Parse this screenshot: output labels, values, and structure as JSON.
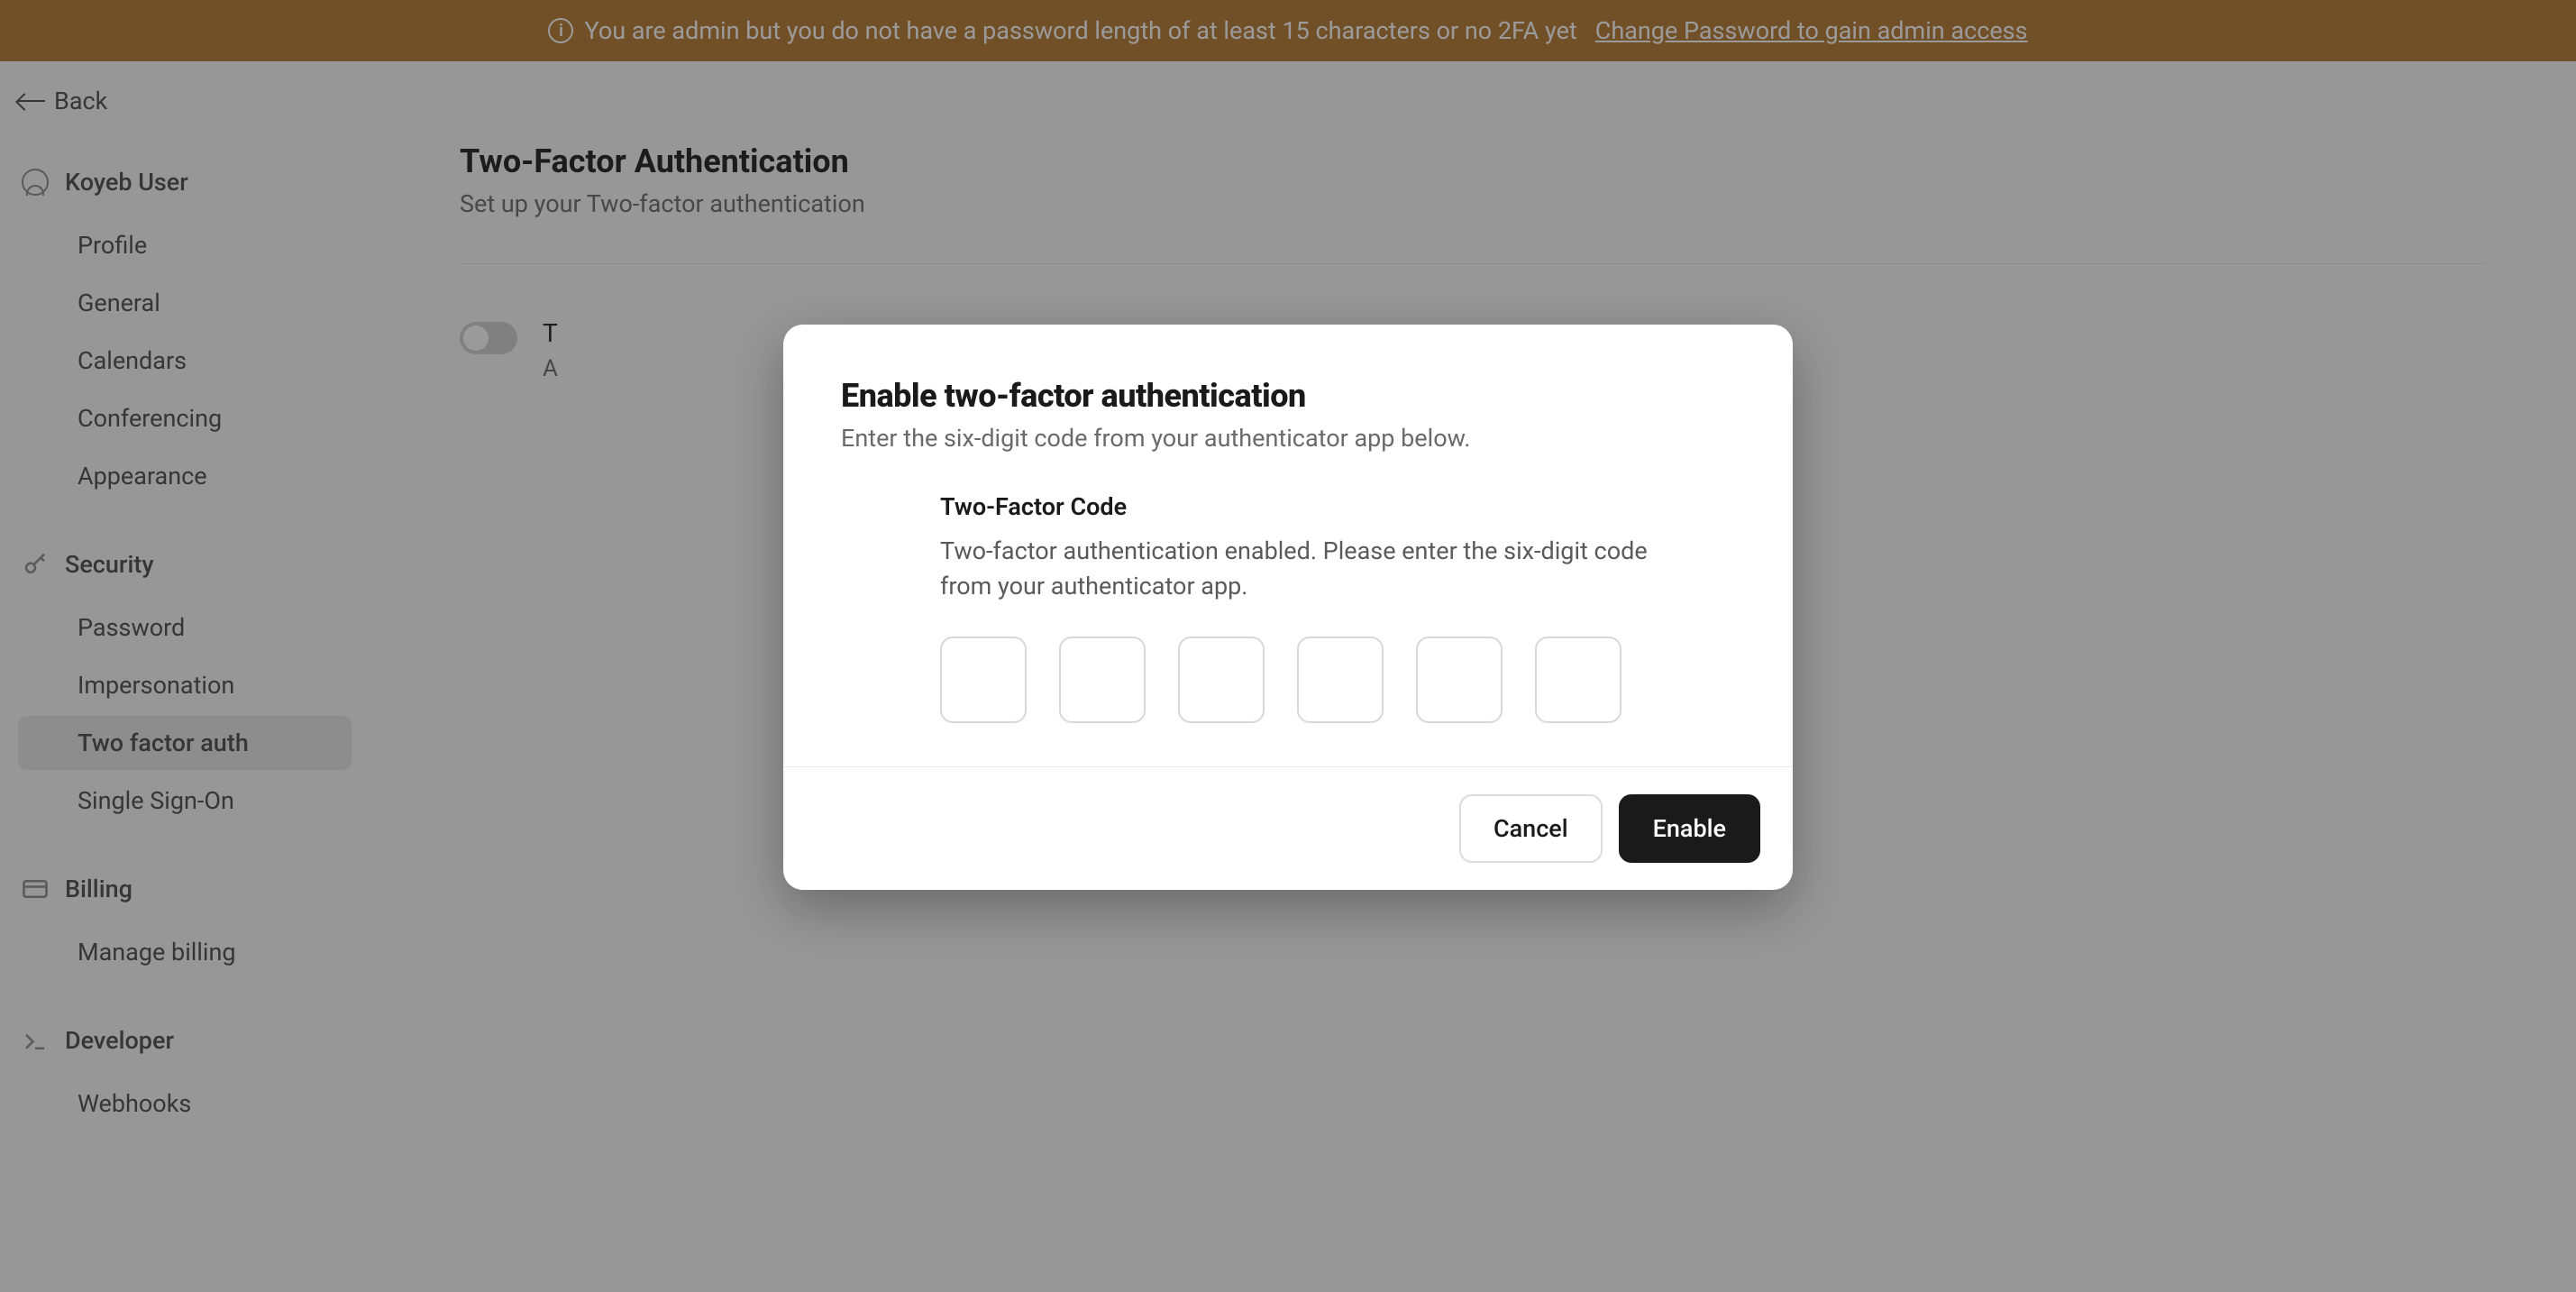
{
  "banner": {
    "text": "You are admin but you do not have a password length of at least 15 characters or no 2FA yet",
    "link_text": "Change Password to gain admin access"
  },
  "back_label": "Back",
  "sidebar": {
    "user_section": {
      "label": "Koyeb User",
      "items": [
        "Profile",
        "General",
        "Calendars",
        "Conferencing",
        "Appearance"
      ]
    },
    "security_section": {
      "label": "Security",
      "items": [
        "Password",
        "Impersonation",
        "Two factor auth",
        "Single Sign-On"
      ],
      "active_index": 2
    },
    "billing_section": {
      "label": "Billing",
      "items": [
        "Manage billing"
      ]
    },
    "developer_section": {
      "label": "Developer",
      "items": [
        "Webhooks"
      ]
    }
  },
  "page": {
    "title": "Two-Factor Authentication",
    "subtitle": "Set up your Two-factor authentication",
    "toggle_label": "T",
    "toggle_desc": "A"
  },
  "modal": {
    "title": "Enable two-factor authentication",
    "subtitle": "Enter the six-digit code from your authenticator app below.",
    "field_label": "Two-Factor Code",
    "field_desc": "Two-factor authentication enabled. Please enter the six-digit code from your authenticator app.",
    "cancel_label": "Cancel",
    "enable_label": "Enable"
  }
}
